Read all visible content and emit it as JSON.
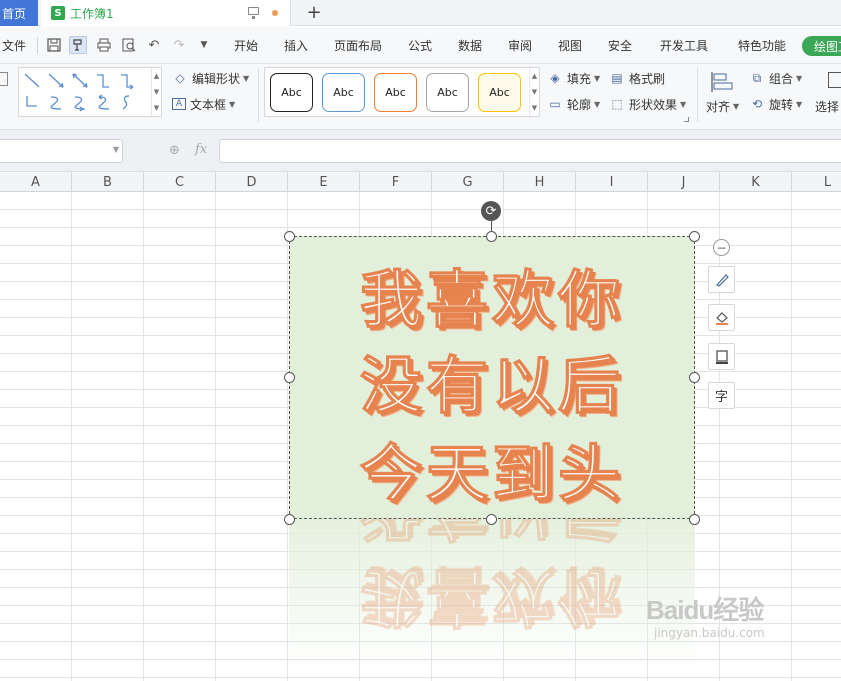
{
  "titlebar": {
    "home_tab": "首页",
    "workbook_tab": "工作簿1",
    "workbook_icon_letter": "S",
    "new_tab_icon": "plus-icon"
  },
  "menubar": {
    "file": "文件",
    "items": [
      "开始",
      "插入",
      "页面布局",
      "公式",
      "数据",
      "审阅",
      "视图",
      "安全",
      "开发工具",
      "特色功能"
    ],
    "active_tab": "绘图工具",
    "quick_icons": [
      "save-icon",
      "format-painter-icon",
      "print-icon",
      "print-preview-icon",
      "undo-icon",
      "redo-icon",
      "more-icon"
    ]
  },
  "ribbon": {
    "edit_shape": "编辑形状",
    "text_box": "文本框",
    "style_swatches": [
      {
        "label": "Abc",
        "border": "#222222"
      },
      {
        "label": "Abc",
        "border": "#5b9bd5"
      },
      {
        "label": "Abc",
        "border": "#ed7d31"
      },
      {
        "label": "Abc",
        "border": "#a5a5a5"
      },
      {
        "label": "Abc",
        "border": "#ffc000"
      }
    ],
    "fill": "填充",
    "format_painter": "格式刷",
    "outline": "轮廓",
    "shape_effects": "形状效果",
    "group": "组合",
    "align": "对齐",
    "rotate": "旋转",
    "select": "选择"
  },
  "formula": {
    "fx": "fx",
    "value": ""
  },
  "columns": [
    "A",
    "B",
    "C",
    "D",
    "E",
    "F",
    "G",
    "H",
    "I",
    "J",
    "K",
    "L"
  ],
  "shape": {
    "lines": [
      "我喜欢你",
      "没有以后",
      "今天到头"
    ],
    "fill_color": "#e2efda",
    "text_outline_color": "#e6834e"
  },
  "side_toolbar": [
    "pen-icon",
    "fill-bucket-icon",
    "outline-icon",
    "text-wrap-icon"
  ],
  "watermark": {
    "brand": "Baidu经验",
    "url": "jingyan.baidu.com"
  }
}
